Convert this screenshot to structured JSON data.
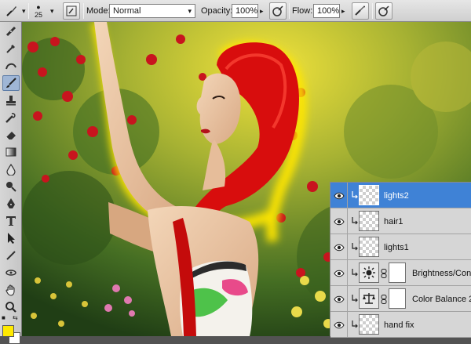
{
  "options_bar": {
    "brush_size": "25",
    "mode_label": "Mode:",
    "mode_value": "Normal",
    "opacity_label": "Opacity:",
    "opacity_value": "100%",
    "flow_label": "Flow:",
    "flow_value": "100%"
  },
  "tools": {
    "foreground_color": "#ffea00",
    "background_color": "#ffffff"
  },
  "layers": [
    {
      "name": "lights2",
      "type": "pixel",
      "selected": true,
      "clipped": true
    },
    {
      "name": "hair1",
      "type": "pixel",
      "selected": false,
      "clipped": true
    },
    {
      "name": "lights1",
      "type": "pixel",
      "selected": false,
      "clipped": true
    },
    {
      "name": "Brightness/Con...",
      "type": "adjustment",
      "icon": "sun-icon",
      "selected": false,
      "clipped": true
    },
    {
      "name": "Color Balance 2",
      "type": "adjustment",
      "icon": "balance-scale-icon",
      "selected": false,
      "clipped": true
    },
    {
      "name": "hand fix",
      "type": "pixel",
      "selected": false,
      "clipped": true
    }
  ],
  "colors": {
    "selection_blue": "#3f82d6",
    "glow_yellow": "#ffe600",
    "hair_red": "#d80d0d"
  }
}
